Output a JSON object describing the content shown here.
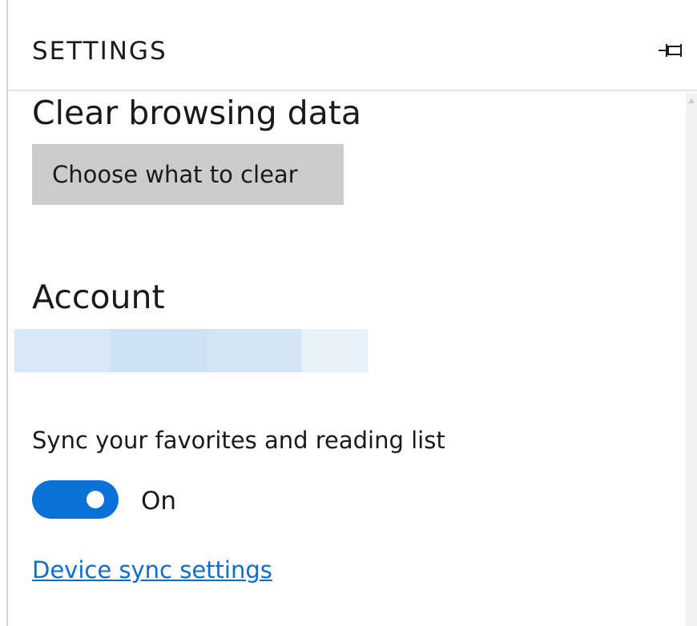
{
  "header": {
    "title": "SETTINGS",
    "pin_icon": "pin-icon"
  },
  "clear_browsing": {
    "heading": "Clear browsing data",
    "button_label": "Choose what to clear"
  },
  "account": {
    "heading": "Account",
    "bar_colors": [
      "#d8e8f6",
      "#cde2f4",
      "#d3e5f5",
      "#e6f1fa"
    ]
  },
  "sync": {
    "label": "Sync your favorites and reading list",
    "toggle_on": true,
    "toggle_state_label": "On",
    "device_link": "Device sync settings"
  },
  "colors": {
    "accent": "#0a72d6",
    "link": "#0a6fd1",
    "button_bg": "#cccccc"
  }
}
